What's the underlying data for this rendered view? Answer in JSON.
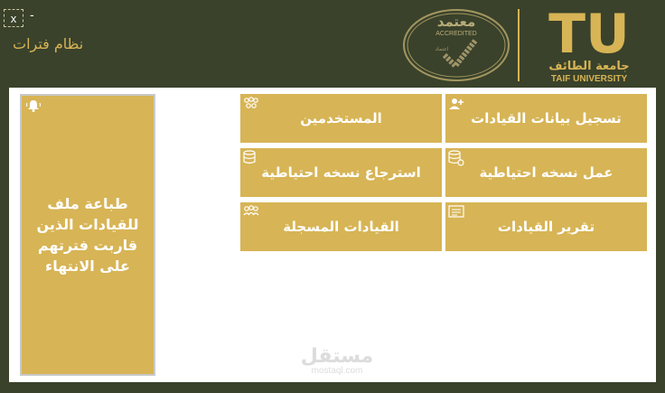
{
  "window": {
    "close_label": "x",
    "minimize_label": "-",
    "title": "نظام فترات"
  },
  "branding": {
    "seal_ar": "معتمد",
    "seal_en": "ACCREDITED",
    "seal_inner": "اعتماد",
    "logo_mark": "TU",
    "logo_ar": "جامعة الطائف",
    "logo_en": "TAIF UNIVERSITY"
  },
  "print_card": {
    "label": "طباعة ملف للقيادات الذين قاربت فترتهم على الانتهاء",
    "icon": "bell-icon"
  },
  "tiles": [
    {
      "label": "تسجيل بيانات القيادات",
      "icon": "add-user-icon"
    },
    {
      "label": "المستخدمين",
      "icon": "users-group-icon"
    },
    {
      "label": "عمل نسخه احتياطية",
      "icon": "database-backup-icon"
    },
    {
      "label": "استرجاع نسخه احتياطية",
      "icon": "database-restore-icon"
    },
    {
      "label": "تقرير القيادات",
      "icon": "report-icon"
    },
    {
      "label": "القيادات المسجلة",
      "icon": "leaders-group-icon"
    }
  ],
  "watermark": {
    "ar": "مستقل",
    "en": "mostaql.com"
  },
  "colors": {
    "background": "#3a422b",
    "accent": "#d7b455",
    "panel": "#ffffff"
  }
}
